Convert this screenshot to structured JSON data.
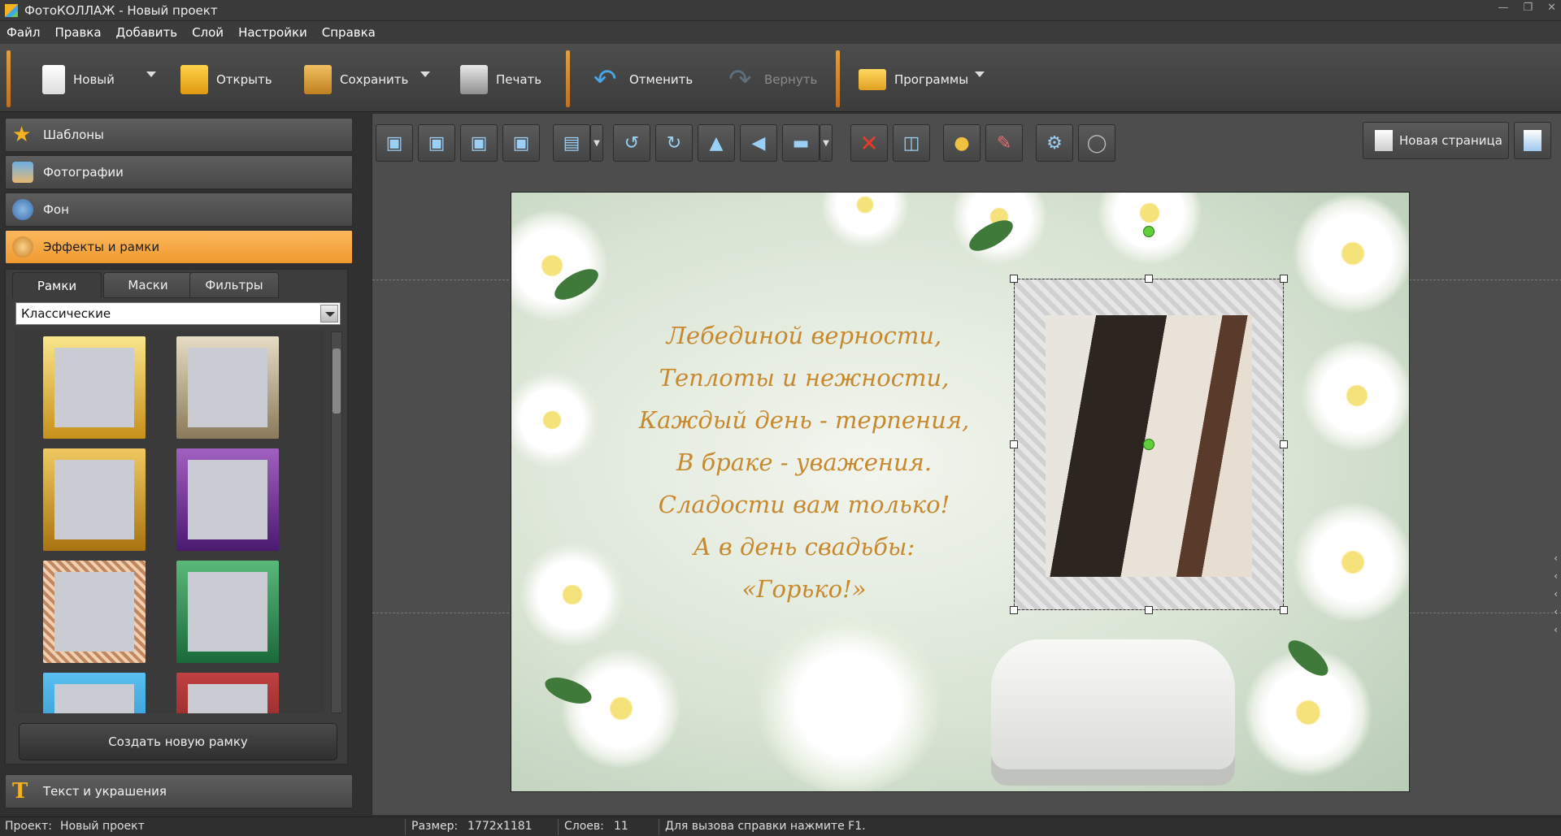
{
  "window": {
    "title": "ФотоКОЛЛАЖ - Новый проект"
  },
  "menu": [
    "Файл",
    "Правка",
    "Добавить",
    "Слой",
    "Настройки",
    "Справка"
  ],
  "toolbar": {
    "new_label": "Новый",
    "open_label": "Открыть",
    "save_label": "Сохранить",
    "print_label": "Печать",
    "undo_label": "Отменить",
    "redo_label": "Вернуть",
    "programs_label": "Программы"
  },
  "sidebar": {
    "templates": "Шаблоны",
    "photos": "Фотографии",
    "background": "Фон",
    "effects": "Эффекты и рамки",
    "text": "Текст и украшения",
    "tabs": [
      "Рамки",
      "Маски",
      "Фильтры"
    ],
    "category": "Классические",
    "create_frame": "Создать новую рамку"
  },
  "editor": {
    "new_page_label": "Новая страница",
    "poem": [
      "Лебединой верности,",
      "Теплоты и нежности,",
      "Каждый день - терпения,",
      "В браке - уважения.",
      "Сладости вам только!",
      "А в день свадьбы: «Горько!»"
    ]
  },
  "status": {
    "project_label": "Проект:",
    "project_value": "Новый проект",
    "size_label": "Размер:",
    "size_value": "1772x1181",
    "layers_label": "Слоев:",
    "layers_value": "11",
    "help": "Для вызова справки нажмите F1."
  },
  "colors": {
    "accent": "#f5a640",
    "poem_text": "#c8892e"
  }
}
